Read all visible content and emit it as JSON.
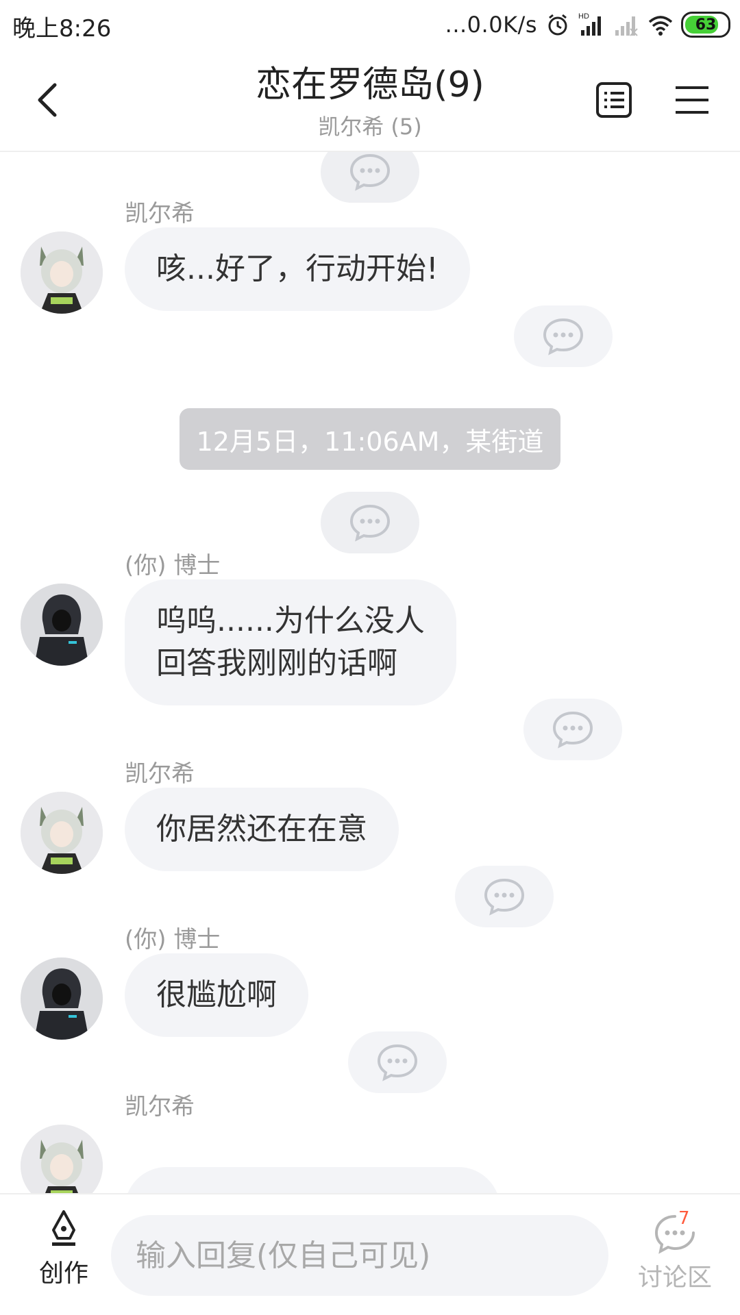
{
  "status_bar": {
    "time": "晚上8:26",
    "net_speed": "...0.0K/s",
    "battery": "63",
    "icons": [
      "alarm-icon",
      "hd-signal-icon",
      "no-signal-icon",
      "wifi-icon",
      "battery-icon"
    ]
  },
  "header": {
    "title": "恋在罗德岛(9)",
    "subtitle": "凯尔希 (5)",
    "icons": [
      "back-arrow-icon",
      "list-icon",
      "menu-icon"
    ]
  },
  "timestamp": "12月5日，11:06AM，某街道",
  "messages": [
    {
      "sender": "凯尔希",
      "text": "咳...好了，行动开始!"
    },
    {
      "sender": "(你) 博士",
      "lines": [
        "呜呜......为什么没人",
        "回答我刚刚的话啊"
      ]
    },
    {
      "sender": "凯尔希",
      "text": "你居然还在在意"
    },
    {
      "sender": "(你) 博士",
      "text": "很尴尬啊"
    },
    {
      "sender": "凯尔希",
      "text": ""
    }
  ],
  "bottom_bar": {
    "create_label": "创作",
    "input_placeholder": "输入回复(仅自己可见)",
    "discussion_label": "讨论区",
    "discussion_badge": "7"
  },
  "colors": {
    "bubble_bg": "#f3f4f7",
    "timestamp_bg": "#d0d0d3",
    "badge": "#ff5a3c",
    "battery_fill": "#46d037"
  }
}
